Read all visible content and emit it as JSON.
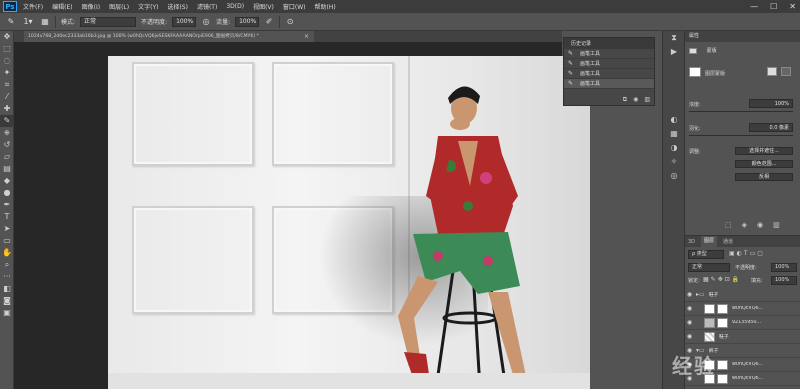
{
  "menubar": {
    "logo": "Ps",
    "items": [
      "文件(F)",
      "编辑(E)",
      "图像(I)",
      "图层(L)",
      "文字(Y)",
      "选择(S)",
      "滤镜(T)",
      "3D(D)",
      "视图(V)",
      "窗口(W)",
      "帮助(H)"
    ],
    "window_controls": [
      "—",
      "☐",
      "✕"
    ]
  },
  "options": {
    "mode_label": "模式:",
    "mode_value": "正常",
    "opacity_label": "不透明度:",
    "opacity_value": "100%",
    "flow_label": "流量:",
    "flow_value": "100%",
    "brush_size": "1"
  },
  "document": {
    "tab_title": "1024x768_2d0ec2333ab16b3.jpg @ 100% (w0hQcVQ6jeSESKFAAAAANOrpiE906_图层拷贝/8/CMYK) *",
    "close_glyph": "×"
  },
  "history": {
    "tab_label": "历史记录",
    "items": [
      {
        "label": "画笔工具",
        "active": false
      },
      {
        "label": "画笔工具",
        "active": false
      },
      {
        "label": "画笔工具",
        "active": false
      },
      {
        "label": "画笔工具",
        "active": true
      }
    ]
  },
  "properties": {
    "tab_label": "属性",
    "mask_label": "蒙版",
    "layer_mask_label": "图层蒙版",
    "density_label": "浓度:",
    "density_value": "100%",
    "feather_label": "羽化:",
    "feather_value": "0.0 像素",
    "adjust_label": "调整:",
    "select_subject_btn": "选择并遮住...",
    "color_range_btn": "颜色范围...",
    "invert_btn": "反相"
  },
  "layers": {
    "tabs": [
      "3D",
      "图层",
      "通道"
    ],
    "active_tab": "图层",
    "kind_filter": "ρ 类型",
    "blend_mode": "正常",
    "opacity_label": "不透明度:",
    "opacity_value": "100%",
    "lock_label": "锁定:",
    "fill_label": "填充:",
    "fill_value": "100%",
    "rows": [
      {
        "type": "group",
        "name": "鞋子"
      },
      {
        "type": "layer",
        "name": "w0hQcVQ6..."
      },
      {
        "type": "layer",
        "name": "92135950..."
      },
      {
        "type": "layer",
        "name": "鞋子"
      },
      {
        "type": "group",
        "name": "裤子"
      },
      {
        "type": "layer",
        "name": "w0hQcVQ6..."
      },
      {
        "type": "layer",
        "name": "w0hQcVQ6..."
      }
    ]
  },
  "watermark": "经验"
}
